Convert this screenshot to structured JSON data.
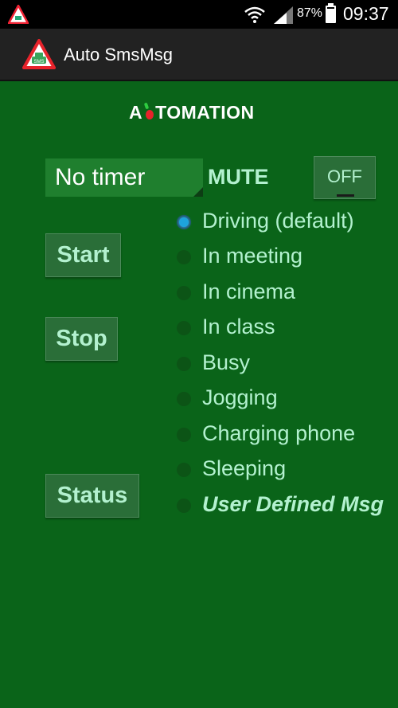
{
  "status_bar": {
    "battery_percent": "87%",
    "time": "09:37",
    "icons": [
      "app-warning-icon",
      "wifi-icon",
      "signal-icon",
      "battery-icon"
    ]
  },
  "action_bar": {
    "title": "Auto SmsMsg"
  },
  "logo": {
    "prefix": "A",
    "suffix": "TOMATION"
  },
  "timer": {
    "selected": "No timer"
  },
  "mute": {
    "label": "MUTE",
    "toggle_state": "OFF"
  },
  "buttons": {
    "start": "Start",
    "stop": "Stop",
    "status": "Status"
  },
  "messages": [
    {
      "label": "Driving (default)",
      "checked": true
    },
    {
      "label": "In meeting",
      "checked": false
    },
    {
      "label": "In cinema",
      "checked": false
    },
    {
      "label": "In class",
      "checked": false
    },
    {
      "label": "Busy",
      "checked": false
    },
    {
      "label": "Jogging",
      "checked": false
    },
    {
      "label": "Charging phone",
      "checked": false
    },
    {
      "label": "Sleeping",
      "checked": false
    },
    {
      "label": "User Defined Msg",
      "checked": false
    }
  ],
  "colors": {
    "background": "#0a6419",
    "text_accent": "#b3f1cf",
    "radio_selected": "#1da3dc"
  }
}
